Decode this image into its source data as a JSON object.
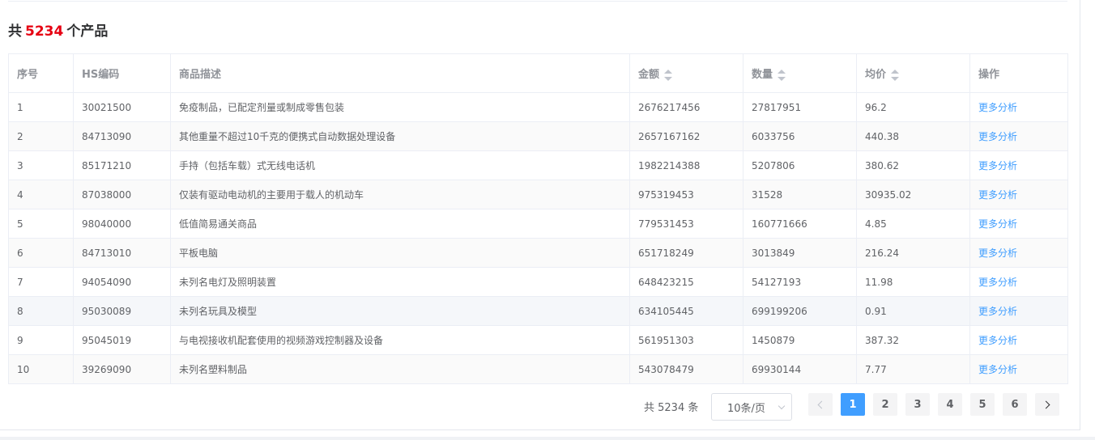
{
  "heading": {
    "prefix": "共",
    "count": "5234",
    "suffix": "个产品"
  },
  "columns": {
    "index": "序号",
    "hs": "HS编码",
    "desc": "商品描述",
    "amount": "金额",
    "qty": "数量",
    "avg": "均价",
    "action": "操作"
  },
  "rows": [
    {
      "index": "1",
      "hs": "30021500",
      "desc": "免疫制品，已配定剂量或制成零售包装",
      "amount": "2676217456",
      "qty": "27817951",
      "avg": "96.2",
      "action": "更多分析"
    },
    {
      "index": "2",
      "hs": "84713090",
      "desc": "其他重量不超过10千克的便携式自动数据处理设备",
      "amount": "2657167162",
      "qty": "6033756",
      "avg": "440.38",
      "action": "更多分析"
    },
    {
      "index": "3",
      "hs": "85171210",
      "desc": "手持（包括车载）式无线电话机",
      "amount": "1982214388",
      "qty": "5207806",
      "avg": "380.62",
      "action": "更多分析"
    },
    {
      "index": "4",
      "hs": "87038000",
      "desc": "仅装有驱动电动机的主要用于载人的机动车",
      "amount": "975319453",
      "qty": "31528",
      "avg": "30935.02",
      "action": "更多分析"
    },
    {
      "index": "5",
      "hs": "98040000",
      "desc": "低值简易通关商品",
      "amount": "779531453",
      "qty": "160771666",
      "avg": "4.85",
      "action": "更多分析"
    },
    {
      "index": "6",
      "hs": "84713010",
      "desc": "平板电脑",
      "amount": "651718249",
      "qty": "3013849",
      "avg": "216.24",
      "action": "更多分析"
    },
    {
      "index": "7",
      "hs": "94054090",
      "desc": "未列名电灯及照明装置",
      "amount": "648423215",
      "qty": "54127193",
      "avg": "11.98",
      "action": "更多分析"
    },
    {
      "index": "8",
      "hs": "95030089",
      "desc": "未列名玩具及模型",
      "amount": "634105445",
      "qty": "699199206",
      "avg": "0.91",
      "action": "更多分析"
    },
    {
      "index": "9",
      "hs": "95045019",
      "desc": "与电视接收机配套使用的视频游戏控制器及设备",
      "amount": "561951303",
      "qty": "1450879",
      "avg": "387.32",
      "action": "更多分析"
    },
    {
      "index": "10",
      "hs": "39269090",
      "desc": "未列名塑料制品",
      "amount": "543078479",
      "qty": "69930144",
      "avg": "7.77",
      "action": "更多分析"
    }
  ],
  "pagination": {
    "total": "共 5234 条",
    "page_size": "10条/页",
    "pages": [
      "1",
      "2",
      "3",
      "4",
      "5",
      "6"
    ],
    "current": "1"
  },
  "colors": {
    "accent": "#409eff",
    "count": "#e60012"
  }
}
